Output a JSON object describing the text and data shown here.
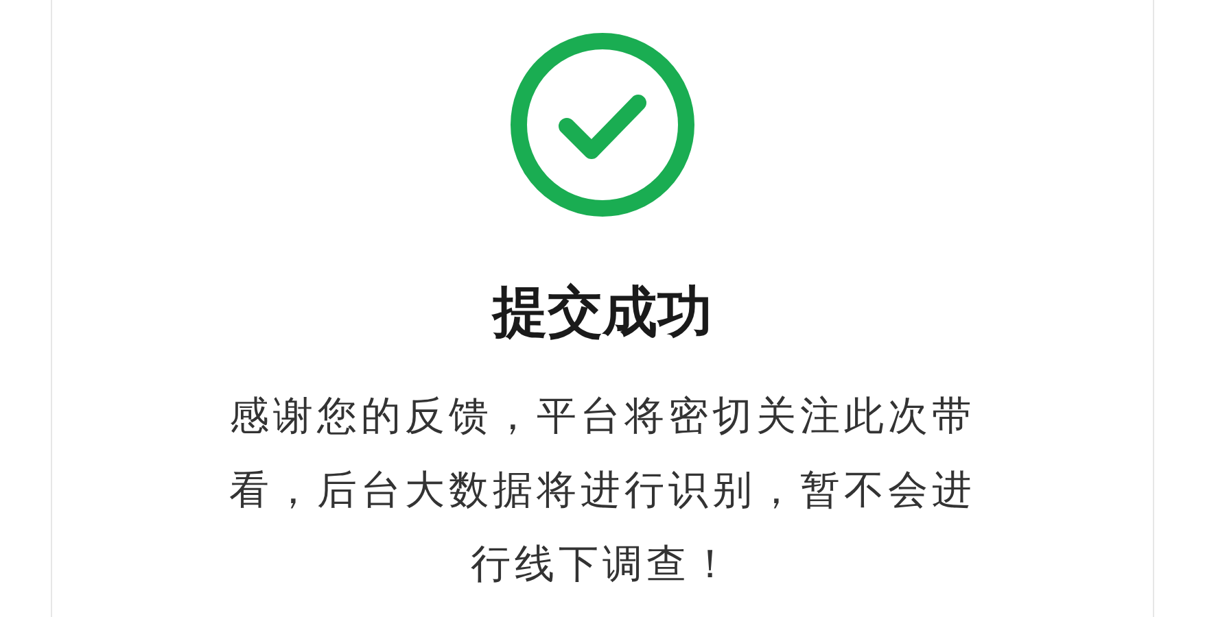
{
  "result": {
    "kind": "success",
    "title": "提交成功",
    "message": "感谢您的反馈，平台将密切关注此次带看，后台大数据将进行识别，暂不会进行线下调查！"
  }
}
